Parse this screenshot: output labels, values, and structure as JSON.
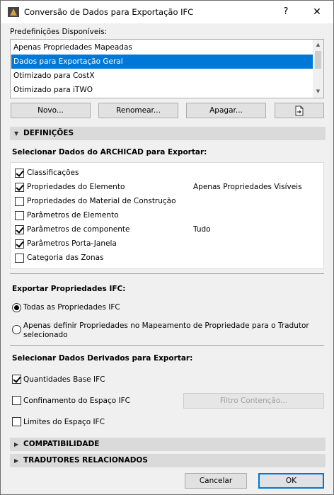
{
  "window": {
    "title": "Conversão de Dados para Exportação IFC",
    "help": "?",
    "close": "✕"
  },
  "presets": {
    "label": "Predefinições Disponíveis:",
    "items": [
      {
        "label": "Apenas Propriedades Mapeadas",
        "selected": false
      },
      {
        "label": "Dados para Exportação Geral",
        "selected": true
      },
      {
        "label": "Otimizado para CostX",
        "selected": false
      },
      {
        "label": "Otimizado para iTWO",
        "selected": false
      }
    ],
    "buttons": {
      "new": "Novo...",
      "rename": "Renomear...",
      "delete": "Apagar..."
    }
  },
  "sections": {
    "definitions": "DEFINIÇÕES",
    "compatibility": "COMPATIBILIDADE",
    "related_translators": "TRADUTORES RELACIONADOS"
  },
  "archicad_data": {
    "label": "Selecionar Dados do ARCHICAD para Exportar:",
    "items": [
      {
        "label": "Classificações",
        "checked": true,
        "value": ""
      },
      {
        "label": "Propriedades do Elemento",
        "checked": true,
        "value": "Apenas Propriedades Visíveis"
      },
      {
        "label": "Propriedades do Material de Construção",
        "checked": false,
        "value": ""
      },
      {
        "label": "Parâmetros de Elemento",
        "checked": false,
        "value": ""
      },
      {
        "label": "Parâmetros de componente",
        "checked": true,
        "value": "Tudo"
      },
      {
        "label": "Parâmetros Porta-Janela",
        "checked": true,
        "value": ""
      },
      {
        "label": "Categoria das Zonas",
        "checked": false,
        "value": ""
      }
    ]
  },
  "ifc_properties": {
    "label": "Exportar Propriedades IFC:",
    "options": [
      {
        "label": "Todas as Propriedades IFC",
        "selected": true
      },
      {
        "label_line1": "Apenas definir Propriedades no Mapeamento de Propriedade para o Tradutor",
        "label_line2": "selecionado",
        "selected": false
      }
    ]
  },
  "derived_data": {
    "label": "Selecionar Dados Derivados para Exportar:",
    "items": [
      {
        "label": "Quantidades Base IFC",
        "checked": true
      },
      {
        "label": "Confinamento do Espaço IFC",
        "checked": false
      },
      {
        "label": "Limites do Espaço IFC",
        "checked": false
      }
    ],
    "containment_filter": "Filtro Contenção..."
  },
  "footer": {
    "cancel": "Cancelar",
    "ok": "OK"
  }
}
